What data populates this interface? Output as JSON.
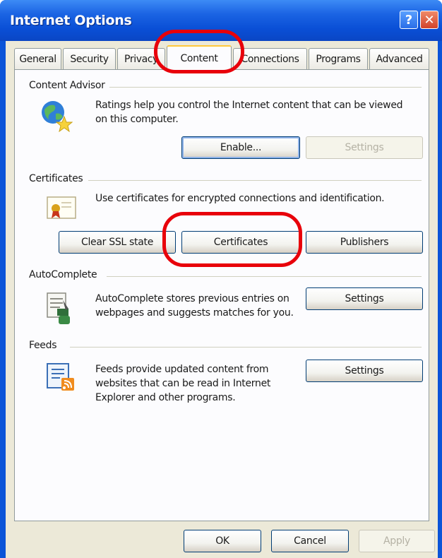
{
  "window": {
    "title": "Internet Options",
    "help_glyph": "?",
    "close_glyph": "✕"
  },
  "tabs": [
    {
      "label": "General"
    },
    {
      "label": "Security"
    },
    {
      "label": "Privacy"
    },
    {
      "label": "Content"
    },
    {
      "label": "Connections"
    },
    {
      "label": "Programs"
    },
    {
      "label": "Advanced"
    }
  ],
  "active_tab": "Content",
  "content_advisor": {
    "heading": "Content Advisor",
    "description": "Ratings help you control the Internet content that can be viewed on this computer.",
    "enable_label": "Enable...",
    "settings_label": "Settings",
    "icon": "globe-icon"
  },
  "certificates": {
    "heading": "Certificates",
    "description": "Use certificates for encrypted connections and identification.",
    "clear_ssl_label": "Clear SSL state",
    "certificates_label": "Certificates",
    "publishers_label": "Publishers",
    "icon": "certificate-icon"
  },
  "autocomplete": {
    "heading": "AutoComplete",
    "description": "AutoComplete stores previous entries on webpages and suggests matches for you.",
    "settings_label": "Settings",
    "icon": "autocomplete-icon"
  },
  "feeds": {
    "heading": "Feeds",
    "description": "Feeds provide updated content from websites that can be read in Internet Explorer and other programs.",
    "settings_label": "Settings",
    "icon": "feeds-icon"
  },
  "footer": {
    "ok_label": "OK",
    "cancel_label": "Cancel",
    "apply_label": "Apply"
  },
  "colors": {
    "title_bar": "#0a4fd6",
    "dialog_bg": "#ece9d8",
    "annotation": "#e8000a",
    "active_tab_accent": "#ffc83c"
  }
}
